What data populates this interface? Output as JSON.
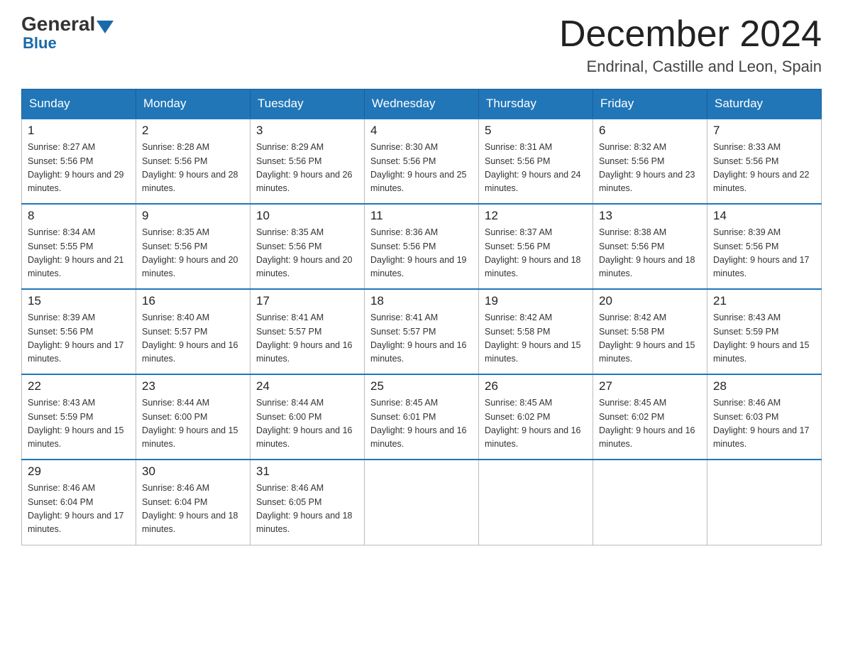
{
  "logo": {
    "general": "General",
    "blue": "Blue"
  },
  "header": {
    "month_title": "December 2024",
    "subtitle": "Endrinal, Castille and Leon, Spain"
  },
  "days_of_week": [
    "Sunday",
    "Monday",
    "Tuesday",
    "Wednesday",
    "Thursday",
    "Friday",
    "Saturday"
  ],
  "weeks": [
    [
      {
        "day": "1",
        "sunrise": "8:27 AM",
        "sunset": "5:56 PM",
        "daylight": "9 hours and 29 minutes."
      },
      {
        "day": "2",
        "sunrise": "8:28 AM",
        "sunset": "5:56 PM",
        "daylight": "9 hours and 28 minutes."
      },
      {
        "day": "3",
        "sunrise": "8:29 AM",
        "sunset": "5:56 PM",
        "daylight": "9 hours and 26 minutes."
      },
      {
        "day": "4",
        "sunrise": "8:30 AM",
        "sunset": "5:56 PM",
        "daylight": "9 hours and 25 minutes."
      },
      {
        "day": "5",
        "sunrise": "8:31 AM",
        "sunset": "5:56 PM",
        "daylight": "9 hours and 24 minutes."
      },
      {
        "day": "6",
        "sunrise": "8:32 AM",
        "sunset": "5:56 PM",
        "daylight": "9 hours and 23 minutes."
      },
      {
        "day": "7",
        "sunrise": "8:33 AM",
        "sunset": "5:56 PM",
        "daylight": "9 hours and 22 minutes."
      }
    ],
    [
      {
        "day": "8",
        "sunrise": "8:34 AM",
        "sunset": "5:55 PM",
        "daylight": "9 hours and 21 minutes."
      },
      {
        "day": "9",
        "sunrise": "8:35 AM",
        "sunset": "5:56 PM",
        "daylight": "9 hours and 20 minutes."
      },
      {
        "day": "10",
        "sunrise": "8:35 AM",
        "sunset": "5:56 PM",
        "daylight": "9 hours and 20 minutes."
      },
      {
        "day": "11",
        "sunrise": "8:36 AM",
        "sunset": "5:56 PM",
        "daylight": "9 hours and 19 minutes."
      },
      {
        "day": "12",
        "sunrise": "8:37 AM",
        "sunset": "5:56 PM",
        "daylight": "9 hours and 18 minutes."
      },
      {
        "day": "13",
        "sunrise": "8:38 AM",
        "sunset": "5:56 PM",
        "daylight": "9 hours and 18 minutes."
      },
      {
        "day": "14",
        "sunrise": "8:39 AM",
        "sunset": "5:56 PM",
        "daylight": "9 hours and 17 minutes."
      }
    ],
    [
      {
        "day": "15",
        "sunrise": "8:39 AM",
        "sunset": "5:56 PM",
        "daylight": "9 hours and 17 minutes."
      },
      {
        "day": "16",
        "sunrise": "8:40 AM",
        "sunset": "5:57 PM",
        "daylight": "9 hours and 16 minutes."
      },
      {
        "day": "17",
        "sunrise": "8:41 AM",
        "sunset": "5:57 PM",
        "daylight": "9 hours and 16 minutes."
      },
      {
        "day": "18",
        "sunrise": "8:41 AM",
        "sunset": "5:57 PM",
        "daylight": "9 hours and 16 minutes."
      },
      {
        "day": "19",
        "sunrise": "8:42 AM",
        "sunset": "5:58 PM",
        "daylight": "9 hours and 15 minutes."
      },
      {
        "day": "20",
        "sunrise": "8:42 AM",
        "sunset": "5:58 PM",
        "daylight": "9 hours and 15 minutes."
      },
      {
        "day": "21",
        "sunrise": "8:43 AM",
        "sunset": "5:59 PM",
        "daylight": "9 hours and 15 minutes."
      }
    ],
    [
      {
        "day": "22",
        "sunrise": "8:43 AM",
        "sunset": "5:59 PM",
        "daylight": "9 hours and 15 minutes."
      },
      {
        "day": "23",
        "sunrise": "8:44 AM",
        "sunset": "6:00 PM",
        "daylight": "9 hours and 15 minutes."
      },
      {
        "day": "24",
        "sunrise": "8:44 AM",
        "sunset": "6:00 PM",
        "daylight": "9 hours and 16 minutes."
      },
      {
        "day": "25",
        "sunrise": "8:45 AM",
        "sunset": "6:01 PM",
        "daylight": "9 hours and 16 minutes."
      },
      {
        "day": "26",
        "sunrise": "8:45 AM",
        "sunset": "6:02 PM",
        "daylight": "9 hours and 16 minutes."
      },
      {
        "day": "27",
        "sunrise": "8:45 AM",
        "sunset": "6:02 PM",
        "daylight": "9 hours and 16 minutes."
      },
      {
        "day": "28",
        "sunrise": "8:46 AM",
        "sunset": "6:03 PM",
        "daylight": "9 hours and 17 minutes."
      }
    ],
    [
      {
        "day": "29",
        "sunrise": "8:46 AM",
        "sunset": "6:04 PM",
        "daylight": "9 hours and 17 minutes."
      },
      {
        "day": "30",
        "sunrise": "8:46 AM",
        "sunset": "6:04 PM",
        "daylight": "9 hours and 18 minutes."
      },
      {
        "day": "31",
        "sunrise": "8:46 AM",
        "sunset": "6:05 PM",
        "daylight": "9 hours and 18 minutes."
      },
      null,
      null,
      null,
      null
    ]
  ]
}
